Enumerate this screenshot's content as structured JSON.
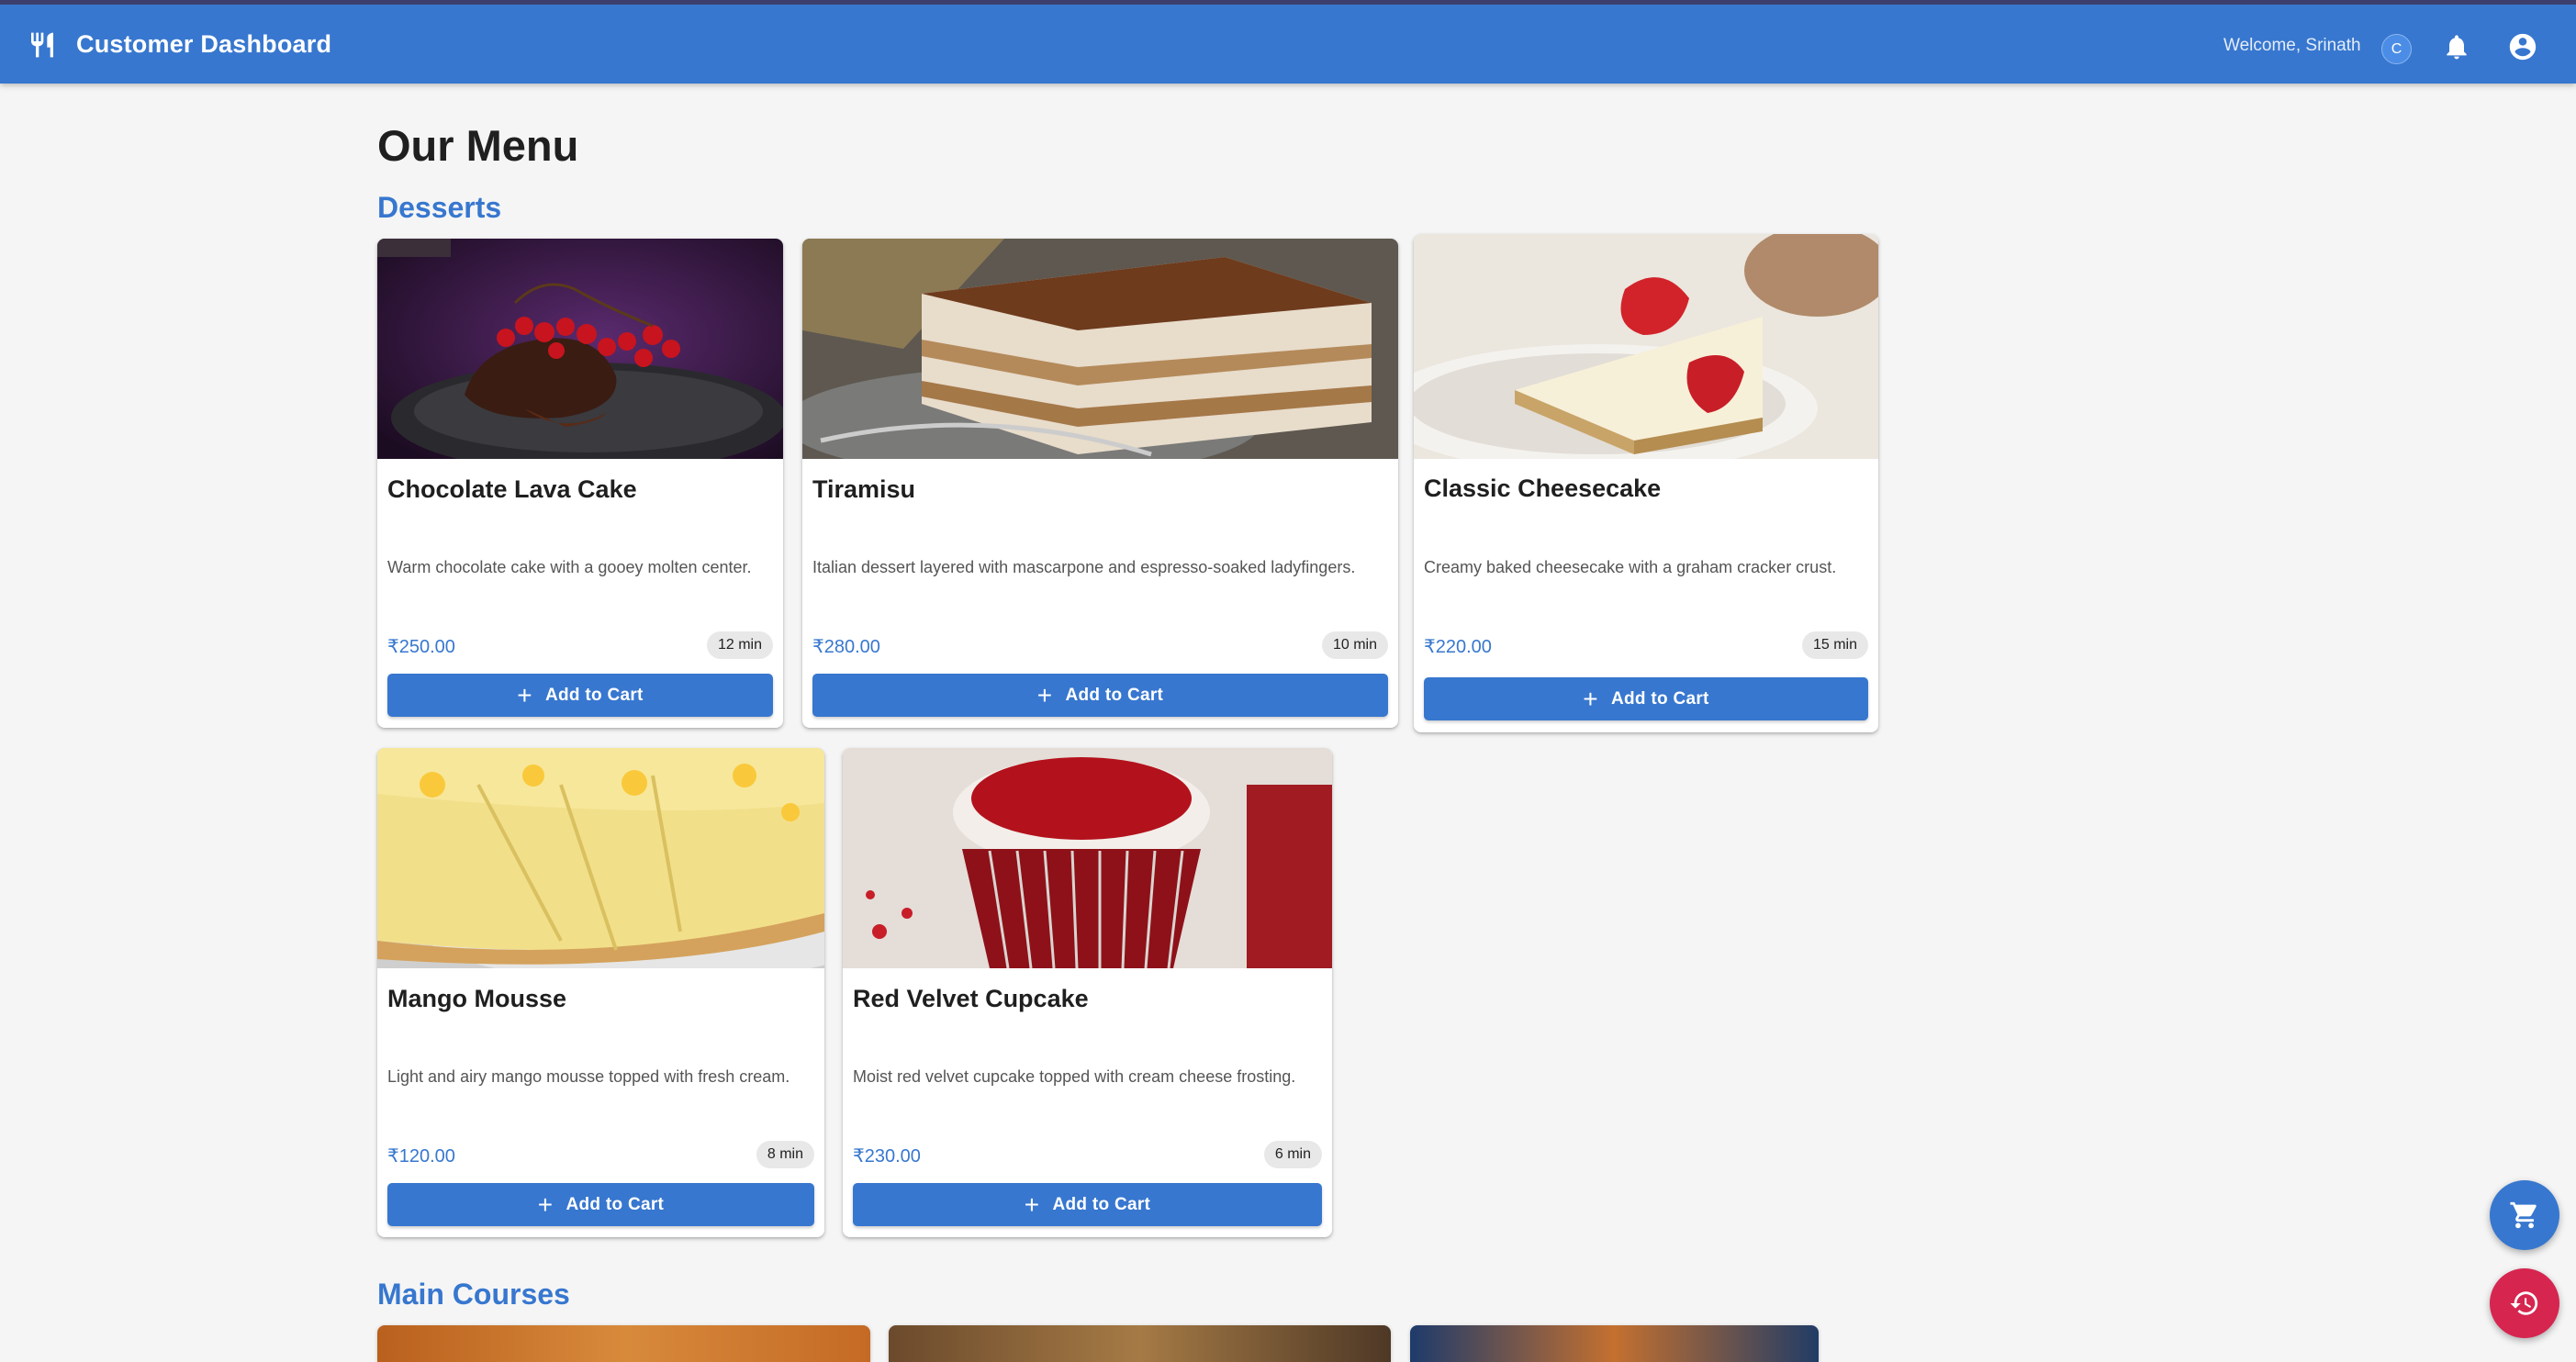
{
  "header": {
    "title": "Customer Dashboard",
    "welcome": "Welcome, Srinath",
    "avatar_letter": "C",
    "icons": [
      "restaurant-icon",
      "notifications-icon",
      "account-circle-icon"
    ],
    "bar_color": "#3777cf"
  },
  "page": {
    "title": "Our Menu"
  },
  "sections": [
    {
      "title": "Desserts",
      "items": [
        {
          "name": "Chocolate Lava Cake",
          "description": "Warm chocolate cake with a gooey molten center.",
          "price": "₹250.00",
          "time": "12 min",
          "button": "Add to Cart"
        },
        {
          "name": "Tiramisu",
          "description": "Italian dessert layered with mascarpone and espresso-soaked ladyfingers.",
          "price": "₹280.00",
          "time": "10 min",
          "button": "Add to Cart"
        },
        {
          "name": "Classic Cheesecake",
          "description": "Creamy baked cheesecake with a graham cracker crust.",
          "price": "₹220.00",
          "time": "15 min",
          "button": "Add to Cart"
        },
        {
          "name": "Mango Mousse",
          "description": "Light and airy mango mousse topped with fresh cream.",
          "price": "₹120.00",
          "time": "8 min",
          "button": "Add to Cart"
        },
        {
          "name": "Red Velvet Cupcake",
          "description": "Moist red velvet cupcake topped with cream cheese frosting.",
          "price": "₹230.00",
          "time": "6 min",
          "button": "Add to Cart"
        }
      ]
    },
    {
      "title": "Main Courses"
    }
  ],
  "fabs": {
    "cart": {
      "icon": "shopping-cart-icon",
      "color": "#3777cf"
    },
    "history": {
      "icon": "history-icon",
      "color": "#d6254f"
    }
  }
}
